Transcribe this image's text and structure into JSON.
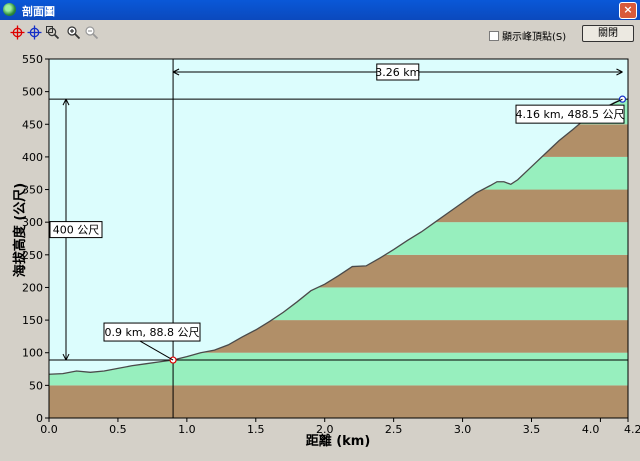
{
  "window": {
    "title": "剖面圖",
    "close_glyph": "×"
  },
  "toolbar": {
    "tools": [
      {
        "icon": "crosshair-red-icon"
      },
      {
        "icon": "crosshair-blue-icon"
      },
      {
        "icon": "zoom-extent-icon"
      },
      {
        "icon": "zoom-in-icon"
      },
      {
        "icon": "zoom-out-icon"
      }
    ],
    "show_peaks_label": "顯示峰頂點(S)",
    "close_label": "關閉"
  },
  "colors": {
    "sky": "#dcfdfd",
    "band_green": "#97efbe",
    "band_brown": "#b18f68",
    "profile_line": "#4a4a4a",
    "window_bg": "#d4d0c8"
  },
  "chart_data": {
    "type": "area",
    "title": "",
    "xlabel": "距離 (km)",
    "ylabel": "海拔高度 (公尺)",
    "xlim": [
      0,
      4.2
    ],
    "ylim": [
      0,
      550
    ],
    "x_ticks": [
      "0.0",
      "0.5",
      "1.0",
      "1.5",
      "2.0",
      "2.5",
      "3.0",
      "3.5",
      "4.0",
      "4.2"
    ],
    "x_tick_values": [
      0,
      0.5,
      1.0,
      1.5,
      2.0,
      2.5,
      3.0,
      3.5,
      4.0,
      4.2
    ],
    "y_ticks": [
      "0",
      "50",
      "100",
      "150",
      "200",
      "250",
      "300",
      "350",
      "400",
      "450",
      "500",
      "550"
    ],
    "y_tick_values": [
      0,
      50,
      100,
      150,
      200,
      250,
      300,
      350,
      400,
      450,
      500,
      550
    ],
    "band_interval": 50,
    "series": [
      {
        "x": [
          0,
          0.1,
          0.2,
          0.3,
          0.4,
          0.5,
          0.6,
          0.7,
          0.8,
          0.9,
          1.0,
          1.1,
          1.2,
          1.3,
          1.4,
          1.5,
          1.6,
          1.7,
          1.8,
          1.9,
          2.0,
          2.1,
          2.2,
          2.3,
          2.4,
          2.5,
          2.6,
          2.7,
          2.8,
          2.9,
          3.0,
          3.1,
          3.2,
          3.25,
          3.3,
          3.35,
          3.4,
          3.5,
          3.6,
          3.7,
          3.8,
          3.9,
          4.0,
          4.1,
          4.16
        ],
        "values": [
          67,
          68,
          72,
          70,
          72,
          76,
          80,
          83,
          86,
          88.8,
          94,
          100,
          104,
          112,
          124,
          135,
          148,
          162,
          178,
          195,
          205,
          218,
          232,
          233,
          245,
          258,
          272,
          285,
          300,
          315,
          330,
          345,
          356,
          362,
          362,
          358,
          365,
          385,
          405,
          425,
          442,
          460,
          472,
          483,
          488.5
        ]
      }
    ],
    "annotations": {
      "point_start": {
        "x": 0.9,
        "y": 88.8,
        "label": "0.9 km, 88.8 公尺"
      },
      "point_end": {
        "x": 4.16,
        "y": 488.5,
        "label": "4.16 km, 488.5 公尺"
      },
      "horizontal_distance": {
        "from": 0.9,
        "to": 4.16,
        "label": "3.26 km"
      },
      "vertical_difference": {
        "from": 88.8,
        "to": 488.5,
        "label": "400 公尺"
      }
    }
  }
}
